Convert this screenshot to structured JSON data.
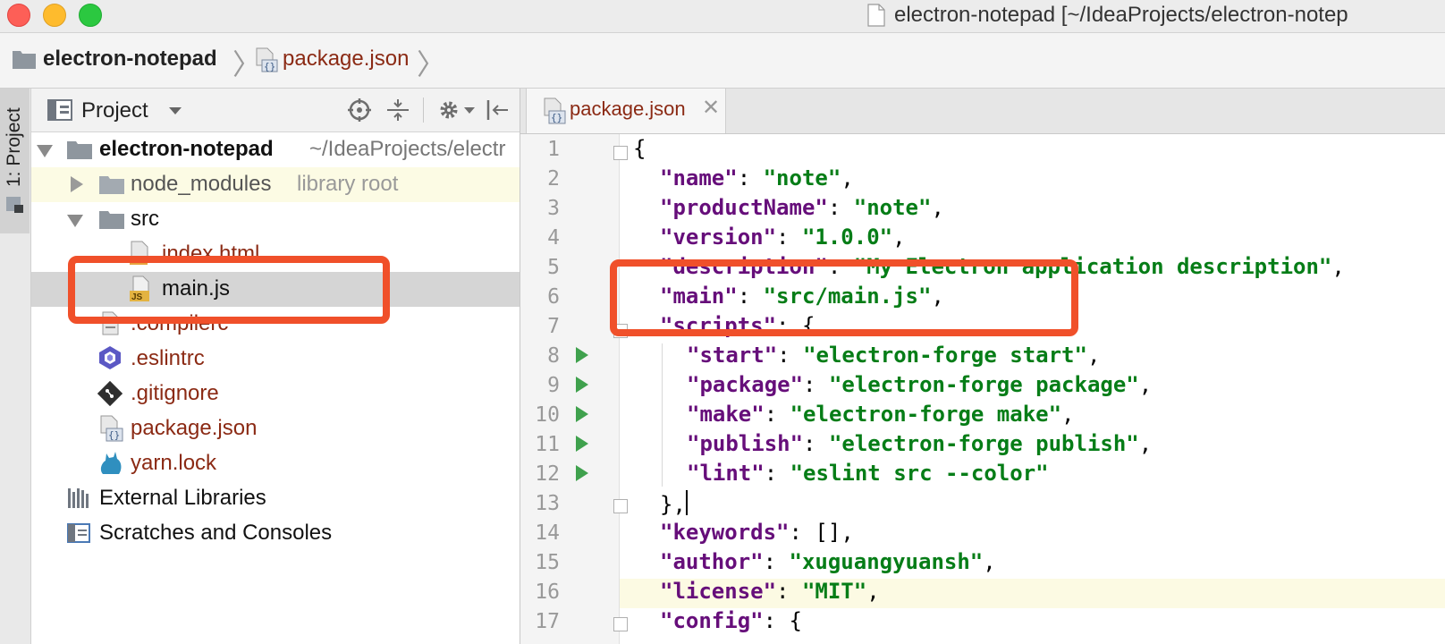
{
  "window": {
    "title": "electron-notepad [~/IdeaProjects/electron-notep"
  },
  "breadcrumb": {
    "project": "electron-notepad",
    "file": "package.json"
  },
  "toolstrip": {
    "tab_label": "1: Project"
  },
  "project_panel": {
    "title": "Project",
    "tree": [
      {
        "label": "electron-notepad",
        "sub": "~/IdeaProjects/electr",
        "kind": "folder",
        "state": "expanded"
      },
      {
        "label": "node_modules",
        "sub": "library root",
        "kind": "folder",
        "state": "collapsed"
      },
      {
        "label": "src",
        "kind": "folder",
        "state": "expanded"
      },
      {
        "label": "index.html",
        "kind": "html-file"
      },
      {
        "label": "main.js",
        "kind": "js-file",
        "selected": true
      },
      {
        "label": ".compilerc",
        "kind": "text-file"
      },
      {
        "label": ".eslintrc",
        "kind": "eslint-file"
      },
      {
        "label": ".gitignore",
        "kind": "git-file"
      },
      {
        "label": "package.json",
        "kind": "json-file"
      },
      {
        "label": "yarn.lock",
        "kind": "yarn-file"
      },
      {
        "label": "External Libraries",
        "kind": "libraries"
      },
      {
        "label": "Scratches and Consoles",
        "kind": "scratches"
      }
    ]
  },
  "editor": {
    "active_tab": "package.json",
    "line_numbers": [
      "1",
      "2",
      "3",
      "4",
      "5",
      "6",
      "7",
      "8",
      "9",
      "10",
      "11",
      "12",
      "13",
      "14",
      "15",
      "16",
      "17"
    ],
    "code": {
      "l1": "{",
      "l2_key": "\"name\"",
      "l2_val": "\"note\"",
      "l3_key": "\"productName\"",
      "l3_val": "\"note\"",
      "l4_key": "\"version\"",
      "l4_val": "\"1.0.0\"",
      "l5_key": "\"description\"",
      "l5_val": "\"My Electron application description\"",
      "l6_key": "\"main\"",
      "l6_val": "\"src/main.js\"",
      "l7_key": "\"scripts\"",
      "l8_key": "\"start\"",
      "l8_val": "\"electron-forge start\"",
      "l9_key": "\"package\"",
      "l9_val": "\"electron-forge package\"",
      "l10_key": "\"make\"",
      "l10_val": "\"electron-forge make\"",
      "l11_key": "\"publish\"",
      "l11_val": "\"electron-forge publish\"",
      "l12_key": "\"lint\"",
      "l12_val": "\"eslint src --color\"",
      "l13": "},",
      "l14_key": "\"keywords\"",
      "l14_val": "[]",
      "l15_key": "\"author\"",
      "l15_val": "\"xuguangyuansh\"",
      "l16_key": "\"license\"",
      "l16_val": "\"MIT\"",
      "l17_key": "\"config\""
    }
  },
  "colors": {
    "annotation": "#f0502a",
    "json_key": "#660e7a",
    "json_string": "#067d17",
    "file_modified": "#8b2a14"
  }
}
